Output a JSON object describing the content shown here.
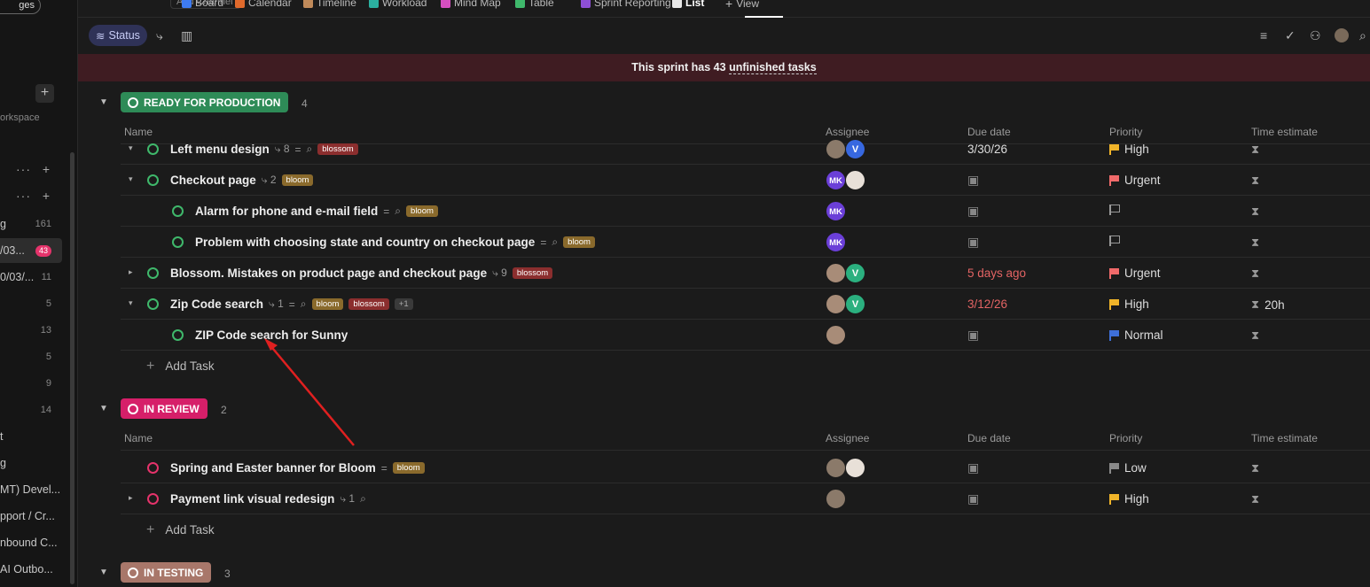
{
  "sidebar": {
    "pill_label": "ges",
    "workspace_label": "orkspace",
    "rows": [
      {
        "label": "g",
        "count": "161"
      },
      {
        "label": "/03...",
        "badge": "43"
      },
      {
        "label": "0/03/...",
        "count": "11"
      },
      {
        "label": "",
        "count": "5"
      },
      {
        "label": "",
        "count": "13"
      },
      {
        "label": "",
        "count": "5"
      },
      {
        "label": "",
        "count": "9"
      },
      {
        "label": "",
        "count": "14"
      },
      {
        "label": "t",
        "count": ""
      },
      {
        "label": "g",
        "count": ""
      },
      {
        "label": "MT) Devel...",
        "count": ""
      },
      {
        "label": "pport / Cr...",
        "count": ""
      },
      {
        "label": "nbound C...",
        "count": ""
      },
      {
        "label": "AI Outbo...",
        "count": ""
      }
    ]
  },
  "topnav": {
    "add_channel": "Add Channel",
    "tabs": [
      {
        "label": "Board",
        "color": "#3e7bf0"
      },
      {
        "label": "Calendar",
        "color": "#e06a2c",
        "glyph": "31"
      },
      {
        "label": "Timeline",
        "color": "#c08a5a"
      },
      {
        "label": "Workload",
        "color": "#2bb0a0"
      },
      {
        "label": "Mind Map",
        "color": "#d64fc0"
      },
      {
        "label": "Table",
        "color": "#3fb86b"
      },
      {
        "label": "Sprint Reporting",
        "color": "#8e4fd6"
      },
      {
        "label": "List",
        "color": "#e8e8e8"
      }
    ],
    "add_view": "View"
  },
  "toolbar": {
    "status_label": "Status"
  },
  "banner": {
    "prefix": "This sprint has 43",
    "link": "unfinished tasks"
  },
  "columns": {
    "name": "Name",
    "assignee": "Assignee",
    "due": "Due date",
    "priority": "Priority",
    "time": "Time estimate"
  },
  "groups": [
    {
      "label": "READY FOR PRODUCTION",
      "count": "4",
      "color": "#2e8b57",
      "tasks": [
        {
          "title": "Left menu design",
          "subtasks": "8",
          "tags": [
            "blossom"
          ],
          "due": "3/30/26",
          "priority": "High",
          "time": ""
        },
        {
          "title": "Checkout page",
          "subtasks": "2",
          "tags": [
            "bloom"
          ],
          "due": "",
          "priority": "Urgent",
          "time": ""
        },
        {
          "title": "Alarm for phone and e-mail field",
          "subtasks": "",
          "tags": [
            "bloom"
          ],
          "due": "",
          "priority": "",
          "time": ""
        },
        {
          "title": "Problem with choosing state and country on checkout page",
          "subtasks": "",
          "tags": [
            "bloom"
          ],
          "due": "",
          "priority": "",
          "time": ""
        },
        {
          "title": "Blossom. Mistakes on product page and checkout page",
          "subtasks": "9",
          "tags": [
            "blossom"
          ],
          "due": "5 days ago",
          "priority": "Urgent",
          "time": ""
        },
        {
          "title": "Zip Code search",
          "subtasks": "1",
          "tags": [
            "bloom",
            "blossom",
            "+1"
          ],
          "due": "3/12/26",
          "priority": "High",
          "time": "20h"
        },
        {
          "title": "ZIP Code search for Sunny",
          "subtasks": "",
          "tags": [],
          "due": "",
          "priority": "Normal",
          "time": ""
        }
      ],
      "add_task": "Add Task"
    },
    {
      "label": "IN REVIEW",
      "count": "2",
      "color": "#d61f69",
      "tasks": [
        {
          "title": "Spring and Easter banner for Bloom",
          "subtasks": "",
          "tags": [
            "bloom"
          ],
          "due": "",
          "priority": "Low",
          "time": ""
        },
        {
          "title": "Payment link visual redesign",
          "subtasks": "1",
          "tags": [],
          "due": "",
          "priority": "High",
          "time": ""
        }
      ],
      "add_task": "Add Task"
    },
    {
      "label": "IN TESTING",
      "count": "3",
      "color": "#a8776a"
    }
  ],
  "avatars": {
    "mk": "MK",
    "v": "V"
  },
  "colors": {
    "urgent": "#f06a6a",
    "high": "#f0b429",
    "normal": "#3e6fd8",
    "low": "#8a8a8a",
    "annotation_arrow": "#e02020"
  }
}
